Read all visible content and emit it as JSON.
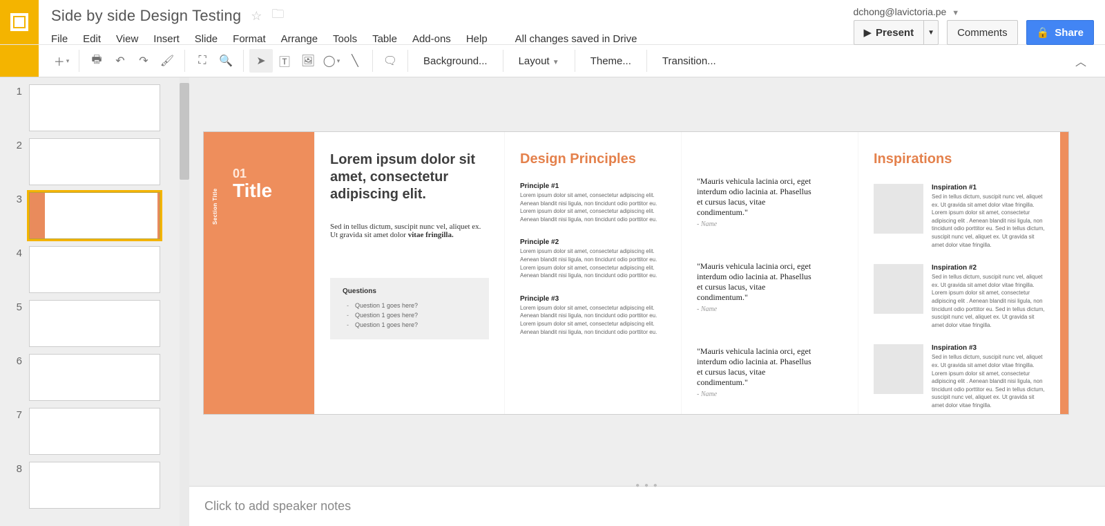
{
  "doc": {
    "title": "Side by side Design Testing",
    "save_status": "All changes saved in Drive"
  },
  "account": {
    "email": "dchong@lavictoria.pe"
  },
  "buttons": {
    "present": "Present",
    "comments": "Comments",
    "share": "Share"
  },
  "menus": {
    "file": "File",
    "edit": "Edit",
    "view": "View",
    "insert": "Insert",
    "slide": "Slide",
    "format": "Format",
    "arrange": "Arrange",
    "tools": "Tools",
    "table": "Table",
    "addons": "Add-ons",
    "help": "Help"
  },
  "toolbar": {
    "background": "Background...",
    "layout": "Layout",
    "theme": "Theme...",
    "transition": "Transition..."
  },
  "thumbs": {
    "count": 8,
    "selected": 3
  },
  "slide": {
    "section_label": "Section Title",
    "number": "01",
    "title": "Title",
    "intro_h": "Lorem ipsum dolor sit amet, consectetur adipiscing elit.",
    "intro_body_prefix": "Sed in tellus dictum, suscipit nunc vel, aliquet ex. Ut gravida sit amet dolor ",
    "intro_body_bold": "vitae fringilla.",
    "principles_h": "Design Principles",
    "principles": [
      {
        "t": "Principle #1",
        "d": "Lorem ipsum dolor sit amet, consectetur adipiscing elit. Aenean blandit nisi ligula, non tincidunt odio porttitor eu. Lorem ipsum dolor sit amet, consectetur adipiscing elit. Aenean blandit nisi ligula, non tincidunt odio porttitor eu."
      },
      {
        "t": "Principle #2",
        "d": "Lorem ipsum dolor sit amet, consectetur adipiscing elit. Aenean blandit nisi ligula, non tincidunt odio porttitor eu. Lorem ipsum dolor sit amet, consectetur adipiscing elit. Aenean blandit nisi ligula, non tincidunt odio porttitor eu."
      },
      {
        "t": "Principle #3",
        "d": "Lorem ipsum dolor sit amet, consectetur adipiscing elit. Aenean blandit nisi ligula, non tincidunt odio porttitor eu. Lorem ipsum dolor sit amet, consectetur adipiscing elit. Aenean blandit nisi ligula, non tincidunt odio porttitor eu."
      }
    ],
    "quotes": [
      {
        "q": "\"Mauris vehicula lacinia orci, eget interdum odio lacinia at. Phasellus et cursus lacus, vitae condimentum.\"",
        "n": "- Name"
      },
      {
        "q": "\"Mauris vehicula lacinia orci, eget interdum odio lacinia at. Phasellus et cursus lacus, vitae condimentum.\"",
        "n": "- Name"
      },
      {
        "q": "\"Mauris vehicula lacinia orci, eget interdum odio lacinia at. Phasellus et cursus lacus, vitae condimentum.\"",
        "n": "- Name"
      }
    ],
    "inspirations_h": "Inspirations",
    "inspirations": [
      {
        "t": "Inspiration #1",
        "d": "Sed in tellus dictum, suscipit nunc vel, aliquet ex. Ut gravida sit amet dolor vitae fringilla. Lorem ipsum dolor sit amet, consectetur adipiscing elit . Aenean blandit nisi ligula, non tincidunt odio porttitor eu. Sed in tellus dictum, suscipit nunc vel, aliquet ex. Ut gravida sit amet dolor vitae fringilla."
      },
      {
        "t": "Inspiration #2",
        "d": "Sed in tellus dictum, suscipit nunc vel, aliquet ex. Ut gravida sit amet dolor vitae fringilla. Lorem ipsum dolor sit amet, consectetur adipiscing elit . Aenean blandit nisi ligula, non tincidunt odio porttitor eu. Sed in tellus dictum, suscipit nunc vel, aliquet ex. Ut gravida sit amet dolor vitae fringilla."
      },
      {
        "t": "Inspiration #3",
        "d": "Sed in tellus dictum, suscipit nunc vel, aliquet ex. Ut gravida sit amet dolor vitae fringilla. Lorem ipsum dolor sit amet, consectetur adipiscing elit . Aenean blandit nisi ligula, non tincidunt odio porttitor eu. Sed in tellus dictum, suscipit nunc vel, aliquet ex. Ut gravida sit amet dolor vitae fringilla."
      }
    ],
    "questions_h": "Questions",
    "questions": [
      "Question 1 goes here?",
      "Question 1 goes here?",
      "Question 1 goes here?"
    ]
  },
  "notes": {
    "placeholder": "Click to add speaker notes"
  }
}
